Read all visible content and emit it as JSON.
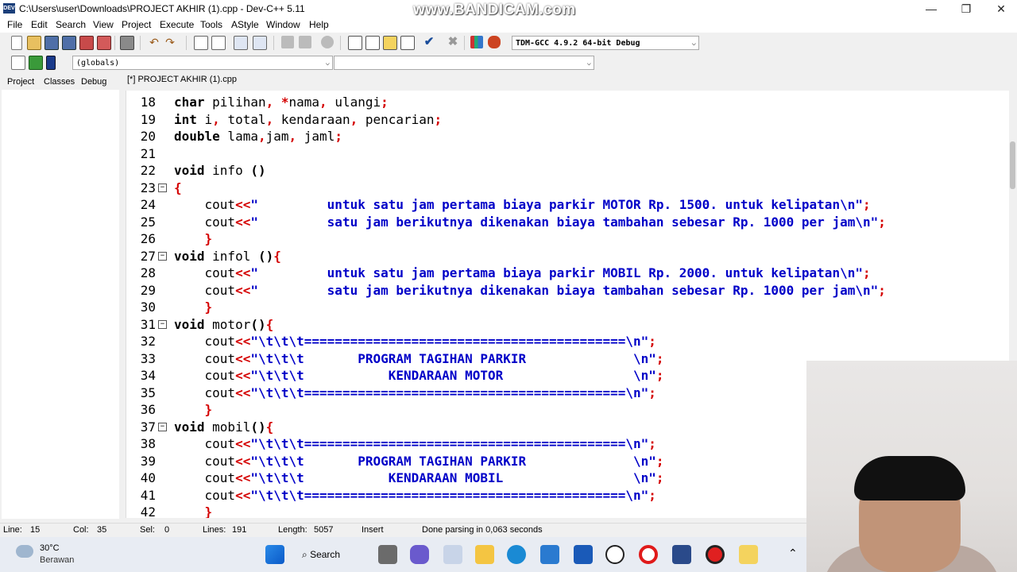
{
  "window": {
    "title": "C:\\Users\\user\\Downloads\\PROJECT AKHIR (1).cpp - Dev-C++ 5.11",
    "watermark": "www.BANDICAM.com",
    "app_icon_label": "DEV"
  },
  "menu": [
    "File",
    "Edit",
    "Search",
    "View",
    "Project",
    "Execute",
    "Tools",
    "AStyle",
    "Window",
    "Help"
  ],
  "toolbar": {
    "compiler": "TDM-GCC 4.9.2 64-bit Debug",
    "scope": "(globals)"
  },
  "left_tabs": [
    "Project",
    "Classes",
    "Debug"
  ],
  "doc_tab": "[*] PROJECT AKHIR (1).cpp",
  "code_lines": [
    {
      "n": "18",
      "text": "char pilihan, *nama, ulangi;"
    },
    {
      "n": "19",
      "text": "int i, total, kendaraan, pencarian;"
    },
    {
      "n": "20",
      "text": "double lama,jam, jaml;"
    },
    {
      "n": "21",
      "text": ""
    },
    {
      "n": "22",
      "text": "void info ()"
    },
    {
      "n": "23",
      "text": "{"
    },
    {
      "n": "24",
      "text": "    cout<<\"         untuk satu jam pertama biaya parkir MOTOR Rp. 1500. untuk kelipatan\\n\";"
    },
    {
      "n": "25",
      "text": "    cout<<\"         satu jam berikutnya dikenakan biaya tambahan sebesar Rp. 1000 per jam\\n\";"
    },
    {
      "n": "26",
      "text": "    }"
    },
    {
      "n": "27",
      "text": "void infol (){"
    },
    {
      "n": "28",
      "text": "    cout<<\"         untuk satu jam pertama biaya parkir MOBIL Rp. 2000. untuk kelipatan\\n\";"
    },
    {
      "n": "29",
      "text": "    cout<<\"         satu jam berikutnya dikenakan biaya tambahan sebesar Rp. 1000 per jam\\n\";"
    },
    {
      "n": "30",
      "text": "    }"
    },
    {
      "n": "31",
      "text": "void motor(){"
    },
    {
      "n": "32",
      "text": "    cout<<\"\\t\\t\\t==========================================\\n\";"
    },
    {
      "n": "33",
      "text": "    cout<<\"\\t\\t\\t       PROGRAM TAGIHAN PARKIR              \\n\";"
    },
    {
      "n": "34",
      "text": "    cout<<\"\\t\\t\\t           KENDARAAN MOTOR                 \\n\";"
    },
    {
      "n": "35",
      "text": "    cout<<\"\\t\\t\\t==========================================\\n\";"
    },
    {
      "n": "36",
      "text": "    }"
    },
    {
      "n": "37",
      "text": "void mobil(){"
    },
    {
      "n": "38",
      "text": "    cout<<\"\\t\\t\\t==========================================\\n\";"
    },
    {
      "n": "39",
      "text": "    cout<<\"\\t\\t\\t       PROGRAM TAGIHAN PARKIR              \\n\";"
    },
    {
      "n": "40",
      "text": "    cout<<\"\\t\\t\\t           KENDARAAN MOBIL                 \\n\";"
    },
    {
      "n": "41",
      "text": "    cout<<\"\\t\\t\\t==========================================\\n\";"
    },
    {
      "n": "42",
      "text": "    }"
    }
  ],
  "status": {
    "line_label": "Line:",
    "line_value": "15",
    "col_label": "Col:",
    "col_value": "35",
    "sel_label": "Sel:",
    "sel_value": "0",
    "lines_label": "Lines:",
    "lines_value": "191",
    "length_label": "Length:",
    "length_value": "5057",
    "mode": "Insert",
    "message": "Done parsing in 0,063 seconds"
  },
  "taskbar": {
    "temperature": "30°C",
    "weather": "Berawan",
    "search": "Search"
  },
  "colors": {
    "keyword": "#000000",
    "string": "#0000c8",
    "operator": "#d40000"
  }
}
